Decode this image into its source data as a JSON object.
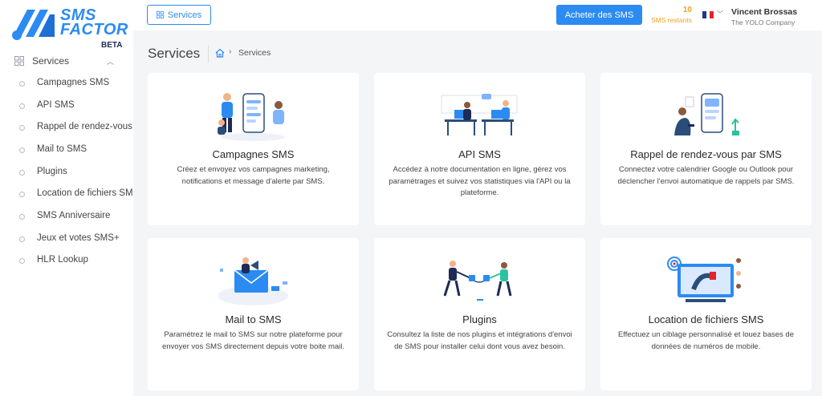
{
  "brand": {
    "line1": "SMS",
    "line2": "FACTOR",
    "badge": "BETA",
    "color": "#2b8bf2"
  },
  "sidebar": {
    "group_label": "Services",
    "items": [
      {
        "label": "Campagnes SMS"
      },
      {
        "label": "API SMS"
      },
      {
        "label": "Rappel de rendez-vous"
      },
      {
        "label": "Mail to SMS"
      },
      {
        "label": "Plugins"
      },
      {
        "label": "Location de fichiers SM"
      },
      {
        "label": "SMS Anniversaire"
      },
      {
        "label": "Jeux et votes SMS+"
      },
      {
        "label": "HLR Lookup"
      }
    ]
  },
  "topbar": {
    "services_button": "Services",
    "buy_button": "Acheter des SMS",
    "credits_count": "10",
    "credits_label": "SMS restants",
    "language_icon": "flag-fr-icon",
    "user_name": "Vincent Brossas",
    "user_company": "The YOLO Company"
  },
  "header": {
    "title": "Services",
    "breadcrumb_current": "Services"
  },
  "cards": [
    {
      "title": "Campagnes SMS",
      "description": "Créez et envoyez vos campagnes marketing, notifications et message d'alerte par SMS."
    },
    {
      "title": "API SMS",
      "description": "Accédez à notre documentation en ligne, gérez vos paramétrages et suivez vos statistiques via l'API ou la plateforme."
    },
    {
      "title": "Rappel de rendez-vous par SMS",
      "description": "Connectez votre calendrier Google ou Outlook pour déclencher l'envoi automatique de rappels par SMS."
    },
    {
      "title": "Mail to SMS",
      "description": "Paramétrez le mail to SMS sur notre plateforme pour envoyer vos SMS directement depuis votre boite mail."
    },
    {
      "title": "Plugins",
      "description": "Consultez la liste de nos plugins et intégrations d'envoi de SMS pour installer celui dont vous avez besoin."
    },
    {
      "title": "Location de fichiers SMS",
      "description": "Effectuez un ciblage personnalisé et louez bases de données de numéros de mobile."
    }
  ]
}
